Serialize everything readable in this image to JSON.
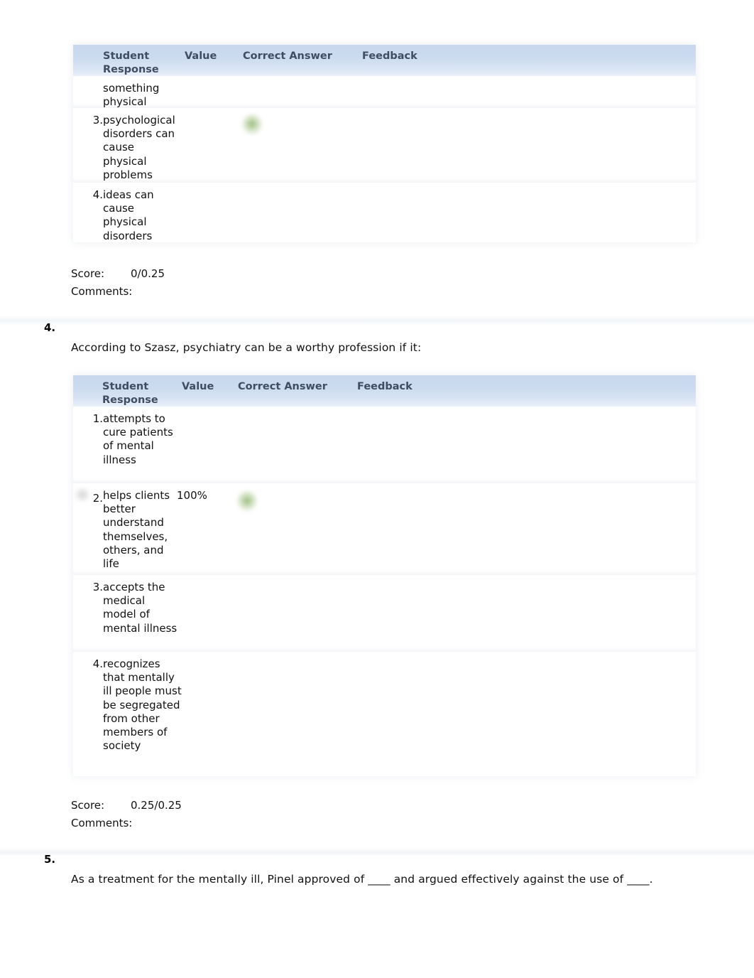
{
  "page": {
    "columns": [
      "Student Response",
      "Value",
      "Correct Answer",
      "Feedback"
    ]
  },
  "table_header": {
    "student_response": "Student\nResponse",
    "value": "Value",
    "correct_answer": "Correct Answer",
    "feedback": "Feedback"
  },
  "labels": {
    "score": "Score:",
    "comments": "Comments:"
  },
  "icons": {
    "correct_marker": "correct-answer-green-dot",
    "selected_marker": "selected-response-smudge"
  },
  "colors": {
    "header_band_top": "#c9d8ee",
    "header_band_bottom": "#e9f0f9",
    "header_text": "#3f4d63",
    "correct_green": "#7eaa5c",
    "page_background": "#ffffff"
  },
  "questions": [
    {
      "number": "",
      "prompt": "",
      "options": [
        {
          "num": "",
          "response": "something physical",
          "value": "",
          "correct": false,
          "selected": false
        },
        {
          "num": "3.",
          "response": "psychological disorders can cause physical problems",
          "value": "",
          "correct": true,
          "selected": false
        },
        {
          "num": "4.",
          "response": "ideas can cause physical disorders",
          "value": "",
          "correct": false,
          "selected": false
        }
      ],
      "score": "0/0.25",
      "comments": ""
    },
    {
      "number": "4.",
      "prompt": "According to Szasz, psychiatry can be a worthy profession if it:",
      "options": [
        {
          "num": "1.",
          "response": "attempts to cure patients of mental illness",
          "value": "",
          "correct": false,
          "selected": false
        },
        {
          "num": "2.",
          "response": "helps clients better understand themselves, others, and life",
          "value": "100%",
          "correct": true,
          "selected": true
        },
        {
          "num": "3.",
          "response": "accepts the medical model of mental illness",
          "value": "",
          "correct": false,
          "selected": false
        },
        {
          "num": "4.",
          "response": "recognizes that mentally ill people must be segregated from other members of society",
          "value": "",
          "correct": false,
          "selected": false
        }
      ],
      "score": "0.25/0.25",
      "comments": ""
    },
    {
      "number": "5.",
      "prompt": "As a treatment for the mentally ill, Pinel approved of ____ and argued effectively against the use of ____.",
      "options": [],
      "score": "",
      "comments": ""
    }
  ]
}
